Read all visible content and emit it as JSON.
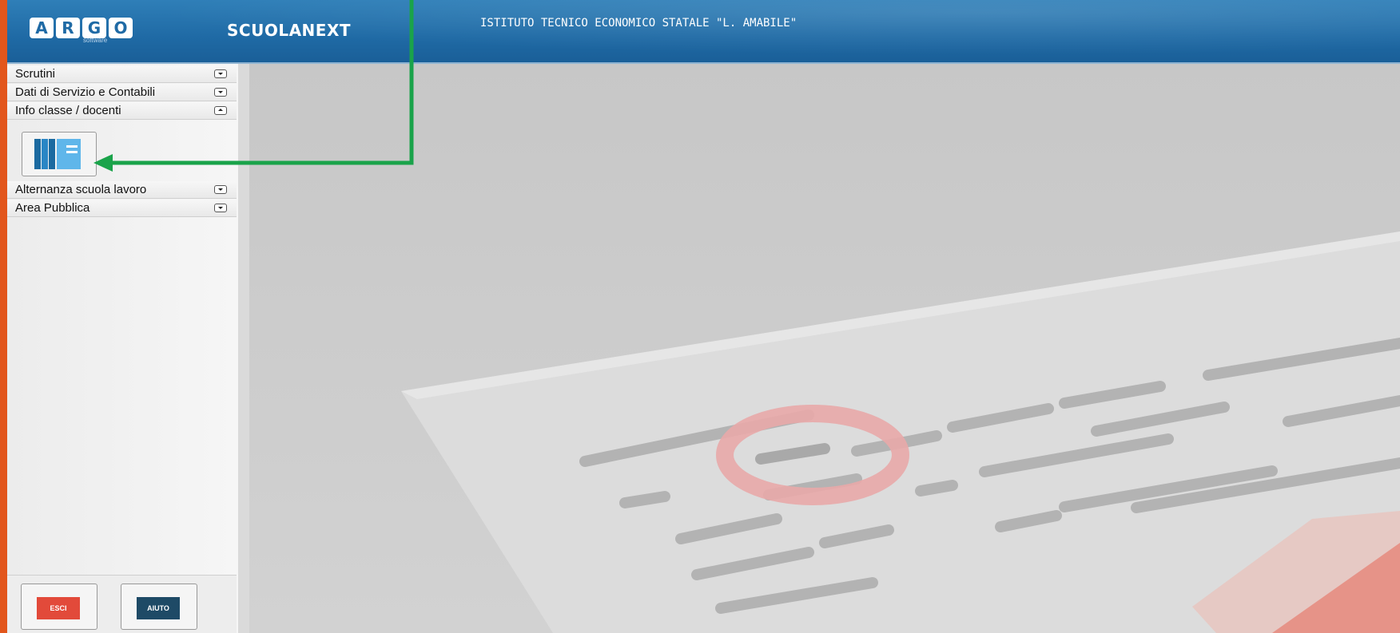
{
  "header": {
    "logo_letters": [
      "A",
      "R",
      "G",
      "O"
    ],
    "logo_sub": "software",
    "product": "SCUOLANEXT",
    "school": "ISTITUTO TECNICO ECONOMICO STATALE \"L. AMABILE\""
  },
  "sidebar": {
    "items": [
      {
        "label": "Scrutini",
        "expanded": false
      },
      {
        "label": "Dati di Servizio e Contabili",
        "expanded": false
      },
      {
        "label": "Info classe / docenti",
        "expanded": true
      },
      {
        "label": "Alternanza scuola lavoro",
        "expanded": false
      },
      {
        "label": "Area Pubblica",
        "expanded": false
      }
    ],
    "panel_icon": "books-icon"
  },
  "buttons": {
    "exit": "ESCI",
    "help": "AIUTO"
  },
  "colors": {
    "header": "#1f6aa5",
    "arrow": "#1aa34a",
    "exit": "#e24a3a",
    "help": "#1e4a66",
    "outer": "#e2561c"
  }
}
